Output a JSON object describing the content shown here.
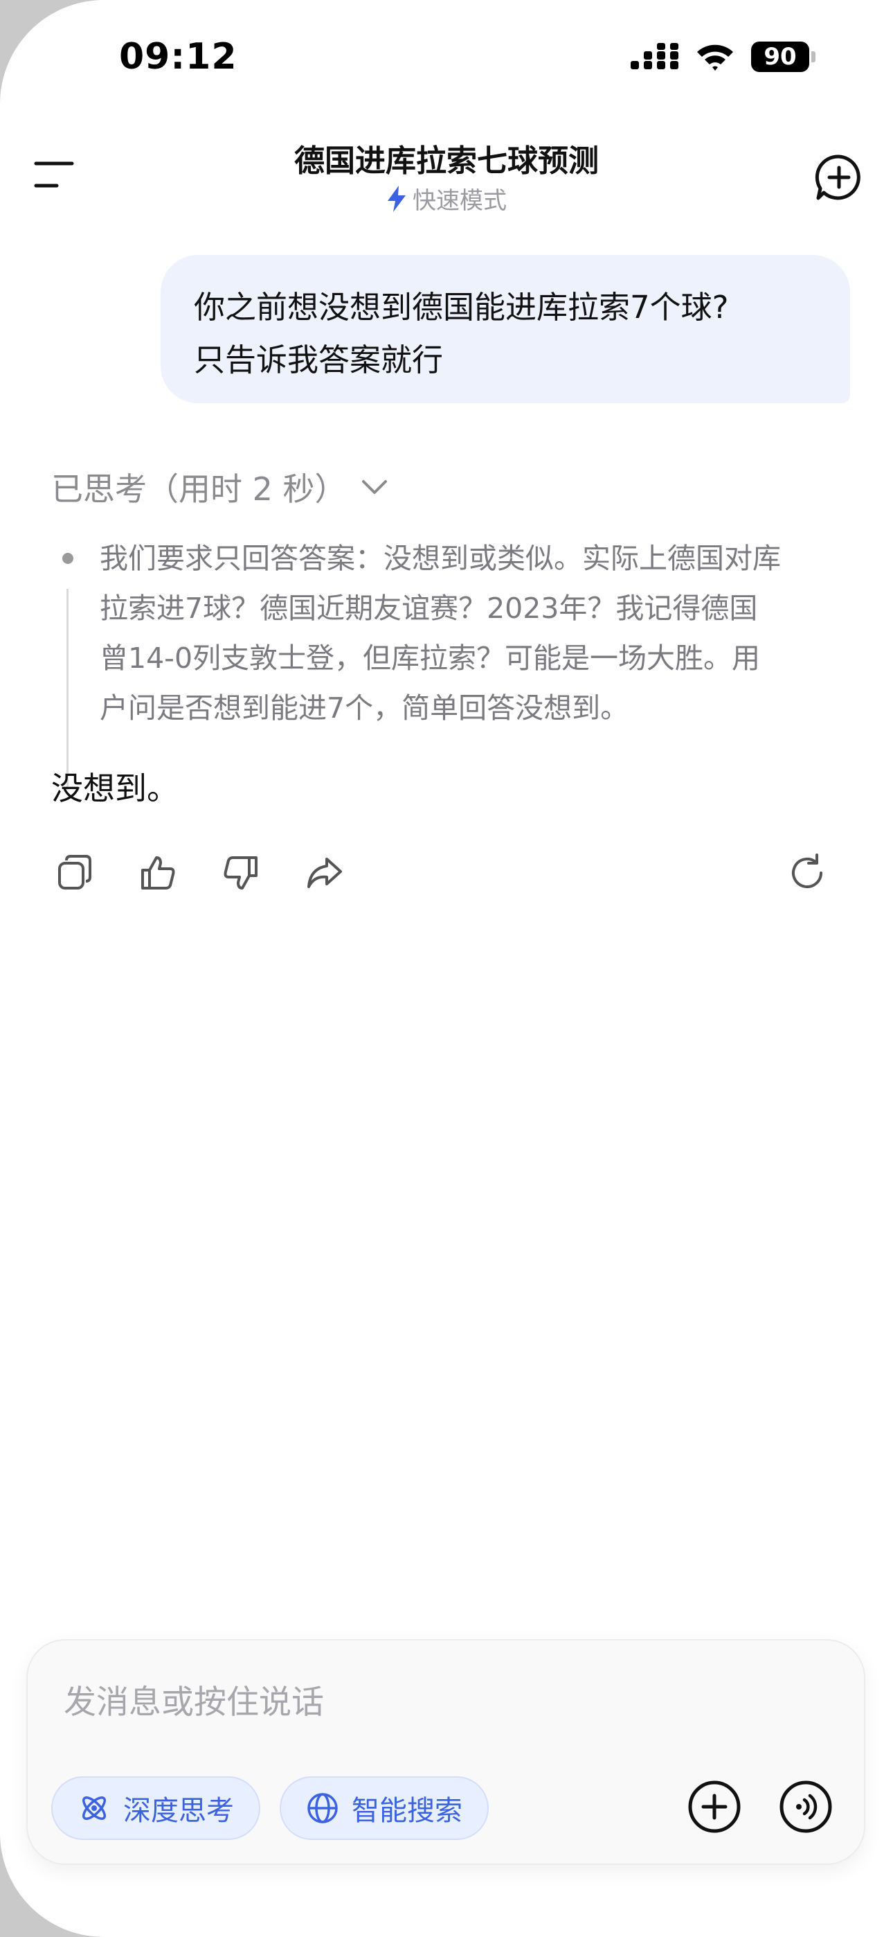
{
  "status_bar": {
    "time": "09:12",
    "battery": "90",
    "icons": [
      "signal-icon",
      "wifi-icon",
      "battery-icon"
    ]
  },
  "header": {
    "title": "德国进库拉索七球预测",
    "mode_label": "快速模式",
    "menu_icon": "menu-icon",
    "new_chat_icon": "new-chat-icon"
  },
  "conversation": {
    "user_message": {
      "line1": "你之前想没想到德国能进库拉索7个球?",
      "line2": "只告诉我答案就行"
    },
    "thinking": {
      "header": "已思考（用时 2 秒）",
      "lines": [
        "我们要求只回答答案：没想到或类似。实际上德国对库",
        "拉索进7球？德国近期友谊赛？2023年？我记得德国",
        "曾14-0列支敦士登，但库拉索？可能是一场大胜。用",
        "户问是否想到能进7个，简单回答没想到。"
      ]
    },
    "answer": "没想到。",
    "actions": [
      "copy-icon",
      "thumbs-up-icon",
      "thumbs-down-icon",
      "share-icon",
      "regenerate-icon"
    ]
  },
  "composer": {
    "placeholder": "发消息或按住说话",
    "deep_think_label": "深度思考",
    "smart_search_label": "智能搜索"
  },
  "colors": {
    "accent": "#3b62e0",
    "user_bubble": "#eef2fd",
    "pill_bg": "#e8efff"
  }
}
